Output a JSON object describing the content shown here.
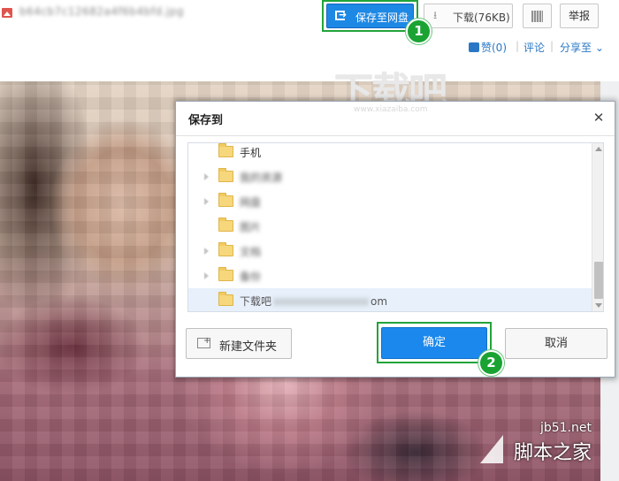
{
  "header": {
    "filename": "b64cb7c12682a4f6b4bfd.jpg",
    "save_to_netdisk": "保存至网盘",
    "download": "下载(76KB)",
    "report": "举报",
    "like": "赞(0)",
    "comment": "评论",
    "share": "分享至",
    "separator": "|",
    "dropdown_caret": "⌄"
  },
  "watermark": {
    "text": "下载吧",
    "url": "www.xiazaiba.com"
  },
  "steps": [
    "1",
    "2"
  ],
  "dialog": {
    "title": "保存到",
    "close_glyph": "✕",
    "folders": [
      {
        "label": "手机",
        "blurred": false,
        "has_arrow": false
      },
      {
        "label": "我的资源",
        "blurred": true,
        "has_arrow": true
      },
      {
        "label": "网盘",
        "blurred": true,
        "has_arrow": true
      },
      {
        "label": "图片",
        "blurred": true,
        "has_arrow": false
      },
      {
        "label": "文档",
        "blurred": true,
        "has_arrow": true
      },
      {
        "label": "备份",
        "blurred": true,
        "has_arrow": true
      },
      {
        "label_prefix": "下载吧",
        "label_suffix": "om",
        "blurred": false,
        "selected": true,
        "has_arrow": false
      }
    ],
    "new_folder": "新建文件夹",
    "ok": "确定",
    "cancel": "取消"
  },
  "site_logo": {
    "url": "jb51.net",
    "name": "脚本之家"
  },
  "colors": {
    "primary_blue": "#1a88ec",
    "highlight_green": "#21a43a",
    "link_blue": "#2a78c5"
  }
}
